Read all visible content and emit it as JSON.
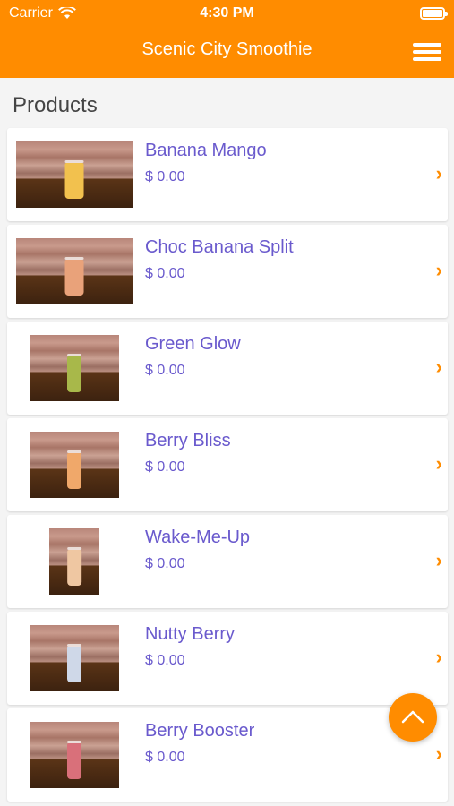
{
  "status_bar": {
    "carrier": "Carrier",
    "time": "4:30 PM"
  },
  "navbar": {
    "title": "Scenic City Smoothie"
  },
  "section": {
    "title": "Products"
  },
  "products": [
    {
      "name": "Banana Mango",
      "price": "$ 0.00",
      "cup_color": "#f2c14e"
    },
    {
      "name": "Choc Banana Split",
      "price": "$ 0.00",
      "cup_color": "#e9a27a"
    },
    {
      "name": "Green Glow",
      "price": "$ 0.00",
      "cup_color": "#a8b84a"
    },
    {
      "name": "Berry Bliss",
      "price": "$ 0.00",
      "cup_color": "#f0a86a"
    },
    {
      "name": "Wake-Me-Up",
      "price": "$ 0.00",
      "cup_color": "#efc7a2"
    },
    {
      "name": "Nutty Berry",
      "price": "$ 0.00",
      "cup_color": "#cfd8e8"
    },
    {
      "name": "Berry Booster",
      "price": "$ 0.00",
      "cup_color": "#d9707a"
    }
  ],
  "icons": {
    "menu": "hamburger-menu-icon",
    "chevron": "chevron-right-icon",
    "scroll_top": "chevron-up-icon"
  },
  "colors": {
    "brand": "#ff8c00",
    "item_text": "#6a5acd"
  }
}
